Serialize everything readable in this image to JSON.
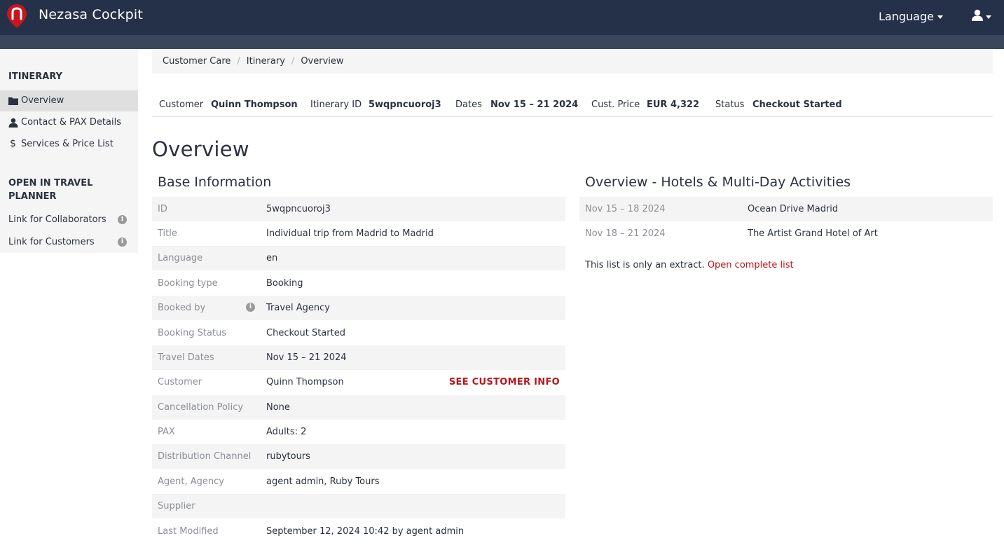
{
  "app": {
    "brand": "Nezasa Cockpit",
    "language_label": "Language",
    "accent_color": "#b8161c",
    "navbar_color": "#243149"
  },
  "sidebar": {
    "section1_heading": "ITINERARY",
    "items": [
      {
        "label": "Overview",
        "icon": "folder-icon",
        "active": true
      },
      {
        "label": "Contact & PAX Details",
        "icon": "user-icon"
      },
      {
        "label": "Services & Price List",
        "icon": "dollar-icon"
      }
    ],
    "section2_heading": "OPEN IN TRAVEL PLANNER",
    "links": [
      {
        "label": "Link for Collaborators",
        "icon": "info-icon"
      },
      {
        "label": "Link for Customers",
        "icon": "info-icon"
      }
    ]
  },
  "breadcrumb": [
    "Customer Care",
    "Itinerary",
    "Overview"
  ],
  "summary": {
    "customer_label": "Customer",
    "customer_value": "Quinn Thompson",
    "itinerary_label": "Itinerary ID",
    "itinerary_value": "5wqpncuoroj3",
    "dates_label": "Dates",
    "dates_value": "Nov 15 – 21 2024",
    "price_label": "Cust. Price",
    "price_value": "EUR 4,322",
    "status_label": "Status",
    "status_value": "Checkout Started"
  },
  "page_title": "Overview",
  "base_info": {
    "title": "Base Information",
    "rows": [
      {
        "label": "ID",
        "value": "5wqpncuoroj3"
      },
      {
        "label": "Title",
        "value": "Individual trip from Madrid to Madrid"
      },
      {
        "label": "Language",
        "value": "en"
      },
      {
        "label": "Booking type",
        "value": "Booking"
      },
      {
        "label": "Booked by",
        "value": "Travel Agency"
      },
      {
        "label": "Booking Status",
        "value": "Checkout Started"
      },
      {
        "label": "Travel Dates",
        "value": "Nov 15 – 21 2024"
      },
      {
        "label": "Customer",
        "value": "Quinn Thompson"
      },
      {
        "label": "Cancellation Policy",
        "value": "None"
      },
      {
        "label": "PAX",
        "value": "Adults: 2"
      },
      {
        "label": "Distribution Channel",
        "value": "rubytours"
      },
      {
        "label": "Agent, Agency",
        "value": "agent admin, Ruby Tours"
      },
      {
        "label": "Supplier",
        "value": ""
      },
      {
        "label": "Last Modified",
        "value": "September 12, 2024 10:42 by agent admin"
      }
    ],
    "see_customer_info": "SEE CUSTOMER INFO"
  },
  "hotels": {
    "title": "Overview - Hotels & Multi-Day Activities",
    "rows": [
      {
        "dates": "Nov 15 – 18 2024",
        "name": "Ocean Drive Madrid"
      },
      {
        "dates": "Nov 18 – 21 2024",
        "name": "The Artist Grand Hotel of Art"
      }
    ],
    "extract_text": "This list is only an extract.",
    "extract_link": "Open complete list"
  }
}
